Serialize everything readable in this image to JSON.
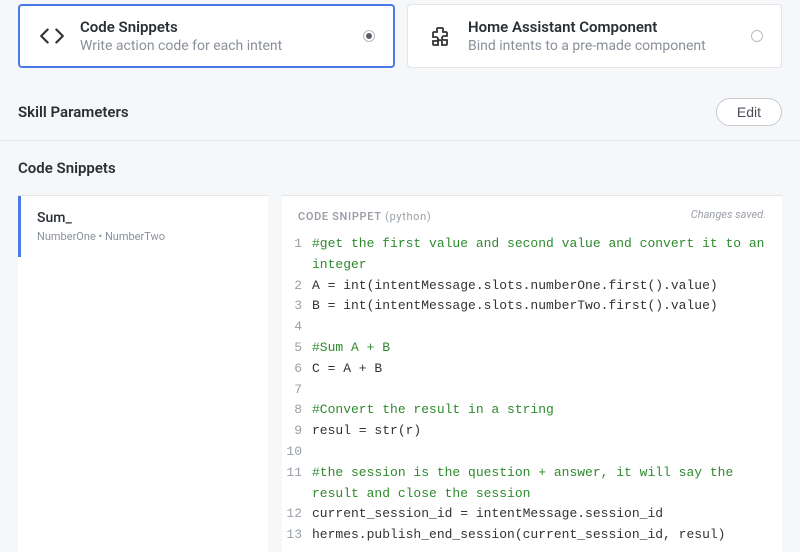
{
  "options": {
    "code": {
      "title": "Code Snippets",
      "subtitle": "Write action code for each intent"
    },
    "ha": {
      "title": "Home Assistant Component",
      "subtitle": "Bind intents to a pre-made component"
    }
  },
  "skillParams": {
    "heading": "Skill Parameters",
    "editLabel": "Edit"
  },
  "snippets": {
    "heading": "Code Snippets",
    "sidebar": {
      "items": [
        {
          "title": "Sum_",
          "slots": "NumberOne  •  NumberTwo"
        }
      ]
    },
    "editor": {
      "label": "CODE SNIPPET",
      "lang": "(python)",
      "status": "Changes saved.",
      "lines": [
        {
          "n": 1,
          "type": "comment",
          "text": "#get the first value and second value and convert it to an integer"
        },
        {
          "n": 2,
          "type": "code",
          "text": "A = int(intentMessage.slots.numberOne.first().value)"
        },
        {
          "n": 3,
          "type": "code",
          "text": "B = int(intentMessage.slots.numberTwo.first().value)"
        },
        {
          "n": 4,
          "type": "code",
          "text": ""
        },
        {
          "n": 5,
          "type": "comment",
          "text": "#Sum A + B"
        },
        {
          "n": 6,
          "type": "code",
          "text": "C = A + B"
        },
        {
          "n": 7,
          "type": "code",
          "text": ""
        },
        {
          "n": 8,
          "type": "comment",
          "text": "#Convert the result in a string"
        },
        {
          "n": 9,
          "type": "code",
          "text": "resul = str(r)"
        },
        {
          "n": 10,
          "type": "code",
          "text": ""
        },
        {
          "n": 11,
          "type": "comment",
          "text": "#the session is the question + answer, it will say the result and close the session"
        },
        {
          "n": 12,
          "type": "code",
          "text": "current_session_id = intentMessage.session_id"
        },
        {
          "n": 13,
          "type": "code",
          "text": "hermes.publish_end_session(current_session_id, resul)"
        }
      ]
    }
  }
}
